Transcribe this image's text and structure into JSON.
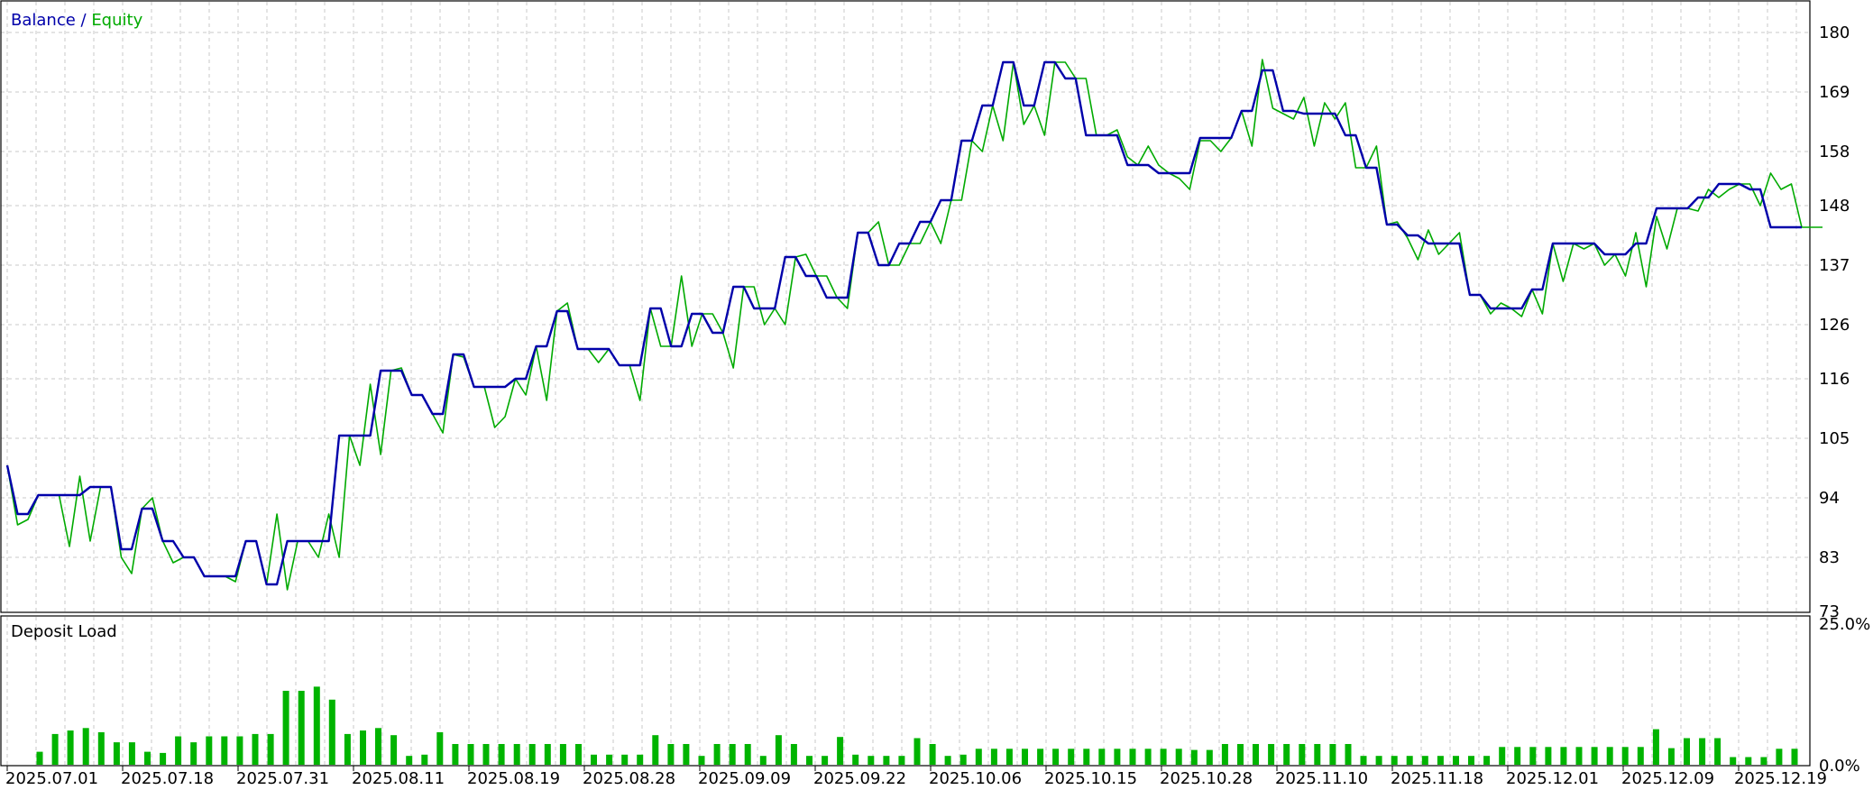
{
  "header": {
    "balance_label": "Balance",
    "separator": " / ",
    "equity_label": "Equity"
  },
  "sub_header": {
    "label": "Deposit Load"
  },
  "colors": {
    "balance": "#0000aa",
    "equity": "#00aa00",
    "load": "#00b400",
    "grid": "#c8c8c8",
    "frame": "#000000"
  },
  "chart_data": [
    {
      "type": "line",
      "title": "Balance / Equity",
      "y_ticks": [
        "180",
        "169",
        "158",
        "148",
        "137",
        "126",
        "116",
        "105",
        "94",
        "83",
        "73"
      ],
      "ylim": [
        73,
        180
      ],
      "x_ticks": [
        "2025.07.01",
        "2025.07.18",
        "2025.07.31",
        "2025.08.11",
        "2025.08.19",
        "2025.08.28",
        "2025.09.09",
        "2025.09.22",
        "2025.10.06",
        "2025.10.15",
        "2025.10.28",
        "2025.11.10",
        "2025.11.18",
        "2025.12.01",
        "2025.12.09",
        "2025.12.19"
      ],
      "grid": true,
      "series": [
        {
          "name": "Balance",
          "values": [
            100,
            91,
            91,
            94.5,
            94.5,
            94.5,
            94.5,
            94.5,
            96,
            96,
            96,
            84.5,
            84.5,
            92,
            92,
            86,
            86,
            83,
            83,
            79.5,
            79.5,
            79.5,
            79.5,
            86,
            86,
            78,
            78,
            86,
            86,
            86,
            86,
            86,
            105.5,
            105.5,
            105.5,
            105.5,
            117.5,
            117.5,
            117.5,
            113,
            113,
            109.5,
            109.5,
            120.5,
            120.5,
            114.5,
            114.5,
            114.5,
            114.5,
            116,
            116,
            122,
            122,
            128.5,
            128.5,
            121.5,
            121.5,
            121.5,
            121.5,
            118.5,
            118.5,
            118.5,
            129,
            129,
            122,
            122,
            128,
            128,
            124.5,
            124.5,
            133,
            133,
            129,
            129,
            129,
            138.5,
            138.5,
            135,
            135,
            131,
            131,
            131,
            143,
            143,
            137,
            137,
            141,
            141,
            145,
            145,
            149,
            149,
            160,
            160,
            166.5,
            166.5,
            174.5,
            174.5,
            166.5,
            166.5,
            174.5,
            174.5,
            171.5,
            171.5,
            161,
            161,
            161,
            161,
            155.5,
            155.5,
            155.5,
            154,
            154,
            154,
            154,
            160.5,
            160.5,
            160.5,
            160.5,
            165.5,
            165.5,
            173,
            173,
            165.5,
            165.5,
            165,
            165,
            165,
            165,
            161,
            161,
            155,
            155,
            144.5,
            144.5,
            142.5,
            142.5,
            141,
            141,
            141,
            141,
            131.5,
            131.5,
            129,
            129,
            129,
            129,
            132.5,
            132.5,
            141,
            141,
            141,
            141,
            141,
            139,
            139,
            139,
            141,
            141,
            147.5,
            147.5,
            147.5,
            147.5,
            149.5,
            149.5,
            152,
            152,
            152,
            151,
            151,
            144,
            144,
            144,
            144
          ]
        },
        {
          "name": "Equity",
          "values": [
            100,
            89,
            90,
            94.5,
            94.5,
            94.5,
            85,
            98,
            86,
            96,
            96,
            83,
            80,
            92,
            94,
            86,
            82,
            83,
            83,
            79.5,
            79.5,
            79.5,
            78.5,
            86,
            86,
            78,
            91,
            77,
            86,
            86,
            83,
            91,
            83,
            105.5,
            100,
            115,
            102,
            117.5,
            118,
            113,
            113,
            109.5,
            106,
            120.5,
            120,
            114.5,
            114.5,
            107,
            109,
            116,
            113,
            122,
            112,
            128.5,
            130,
            121.5,
            121.5,
            119,
            121.5,
            118.5,
            118.5,
            112,
            129,
            122,
            122,
            135,
            122,
            128,
            128,
            124.5,
            118,
            133,
            133,
            126,
            129,
            126,
            138.5,
            139,
            135,
            135,
            131,
            129,
            143,
            143,
            145,
            137,
            137,
            141,
            141,
            145,
            141,
            149,
            149,
            160,
            158,
            166.5,
            160,
            174.5,
            163,
            166.5,
            161,
            174.5,
            174.5,
            171.5,
            171.5,
            161,
            161,
            162,
            157,
            155.5,
            159,
            155.5,
            154,
            153,
            151,
            160,
            160,
            158,
            160.5,
            165.5,
            159,
            175,
            166,
            165,
            164,
            168,
            159,
            167,
            164,
            167,
            155,
            155,
            159,
            144.5,
            145,
            142,
            138,
            143.5,
            139,
            141,
            143,
            131.5,
            131.5,
            128,
            130,
            129,
            127.5,
            132.5,
            128,
            141,
            134,
            141,
            140,
            141,
            137,
            139,
            135,
            143,
            133,
            146,
            140,
            147.5,
            147.5,
            147,
            151,
            149.5,
            151,
            152,
            152,
            148,
            154,
            151,
            152,
            144,
            144,
            144
          ]
        }
      ]
    },
    {
      "type": "bar",
      "title": "Deposit Load",
      "y_ticks": [
        "25.0%",
        "0.0%"
      ],
      "ylim": [
        0,
        25
      ],
      "values": [
        2.2,
        5.2,
        5.8,
        6.2,
        5.5,
        3.8,
        3.8,
        2.2,
        2,
        4.8,
        3.8,
        4.8,
        4.8,
        4.8,
        5.2,
        5.2,
        12.5,
        12.5,
        13.2,
        11,
        5.2,
        5.8,
        6.2,
        5,
        1.5,
        1.7,
        5.5,
        3.5,
        3.5,
        3.5,
        3.5,
        3.5,
        3.5,
        3.5,
        3.5,
        3.5,
        1.7,
        1.7,
        1.7,
        1.7,
        5,
        3.5,
        3.5,
        1.5,
        3.5,
        3.5,
        3.5,
        1.5,
        5,
        3.5,
        1.5,
        1.5,
        4.7,
        1.7,
        1.5,
        1.5,
        1.5,
        4.5,
        3.5,
        1.5,
        1.7,
        2.7,
        2.7,
        2.7,
        2.7,
        2.7,
        2.7,
        2.7,
        2.7,
        2.7,
        2.7,
        2.7,
        2.7,
        2.7,
        2.7,
        2.5,
        2.5,
        3.5,
        3.5,
        3.5,
        3.5,
        3.5,
        3.5,
        3.5,
        3.5,
        3.5,
        1.5,
        1.5,
        1.5,
        1.5,
        1.5,
        1.5,
        1.5,
        1.5,
        1.5,
        3,
        3,
        3,
        3,
        3,
        3,
        3,
        3,
        3,
        3,
        6,
        2.8,
        4.5,
        4.5,
        4.5,
        1.3,
        1.3,
        1.3,
        2.7,
        2.7
      ]
    }
  ]
}
